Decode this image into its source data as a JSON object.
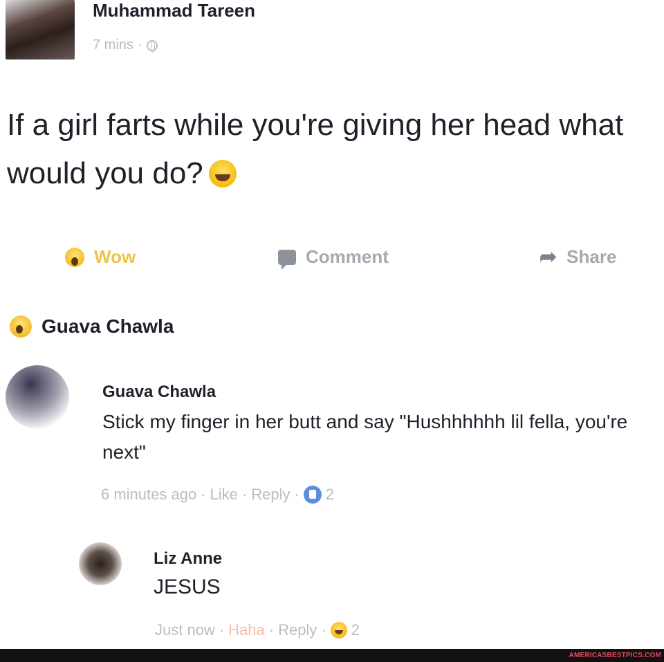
{
  "post": {
    "author_name": "Muhammad Tareen",
    "time": "7 mins",
    "separator": "·",
    "text": "If a girl farts while you're giving her head what would you do?"
  },
  "actions": {
    "wow": "Wow",
    "comment": "Comment",
    "share": "Share"
  },
  "reactors": {
    "name": "Guava Chawla"
  },
  "comments": [
    {
      "name": "Guava Chawla",
      "text": "Stick my finger in her butt and say \"Hushhhhhh lil fella, you're next\"",
      "time": "6 minutes ago",
      "like": "Like",
      "reply": "Reply",
      "reaction_count": "2"
    },
    {
      "name": "Liz Anne",
      "text": "JESUS",
      "time": "Just now",
      "haha": "Haha",
      "reply": "Reply",
      "reaction_count": "2"
    }
  ],
  "watermark": "AMERICASBESTPICS.COM",
  "colors": {
    "wow_yellow": "#f0c24a",
    "muted_gray": "#b9bcc2",
    "like_blue": "#5b8fdd",
    "haha_pink": "#f3bfa3",
    "watermark_red": "#e34a5b"
  }
}
